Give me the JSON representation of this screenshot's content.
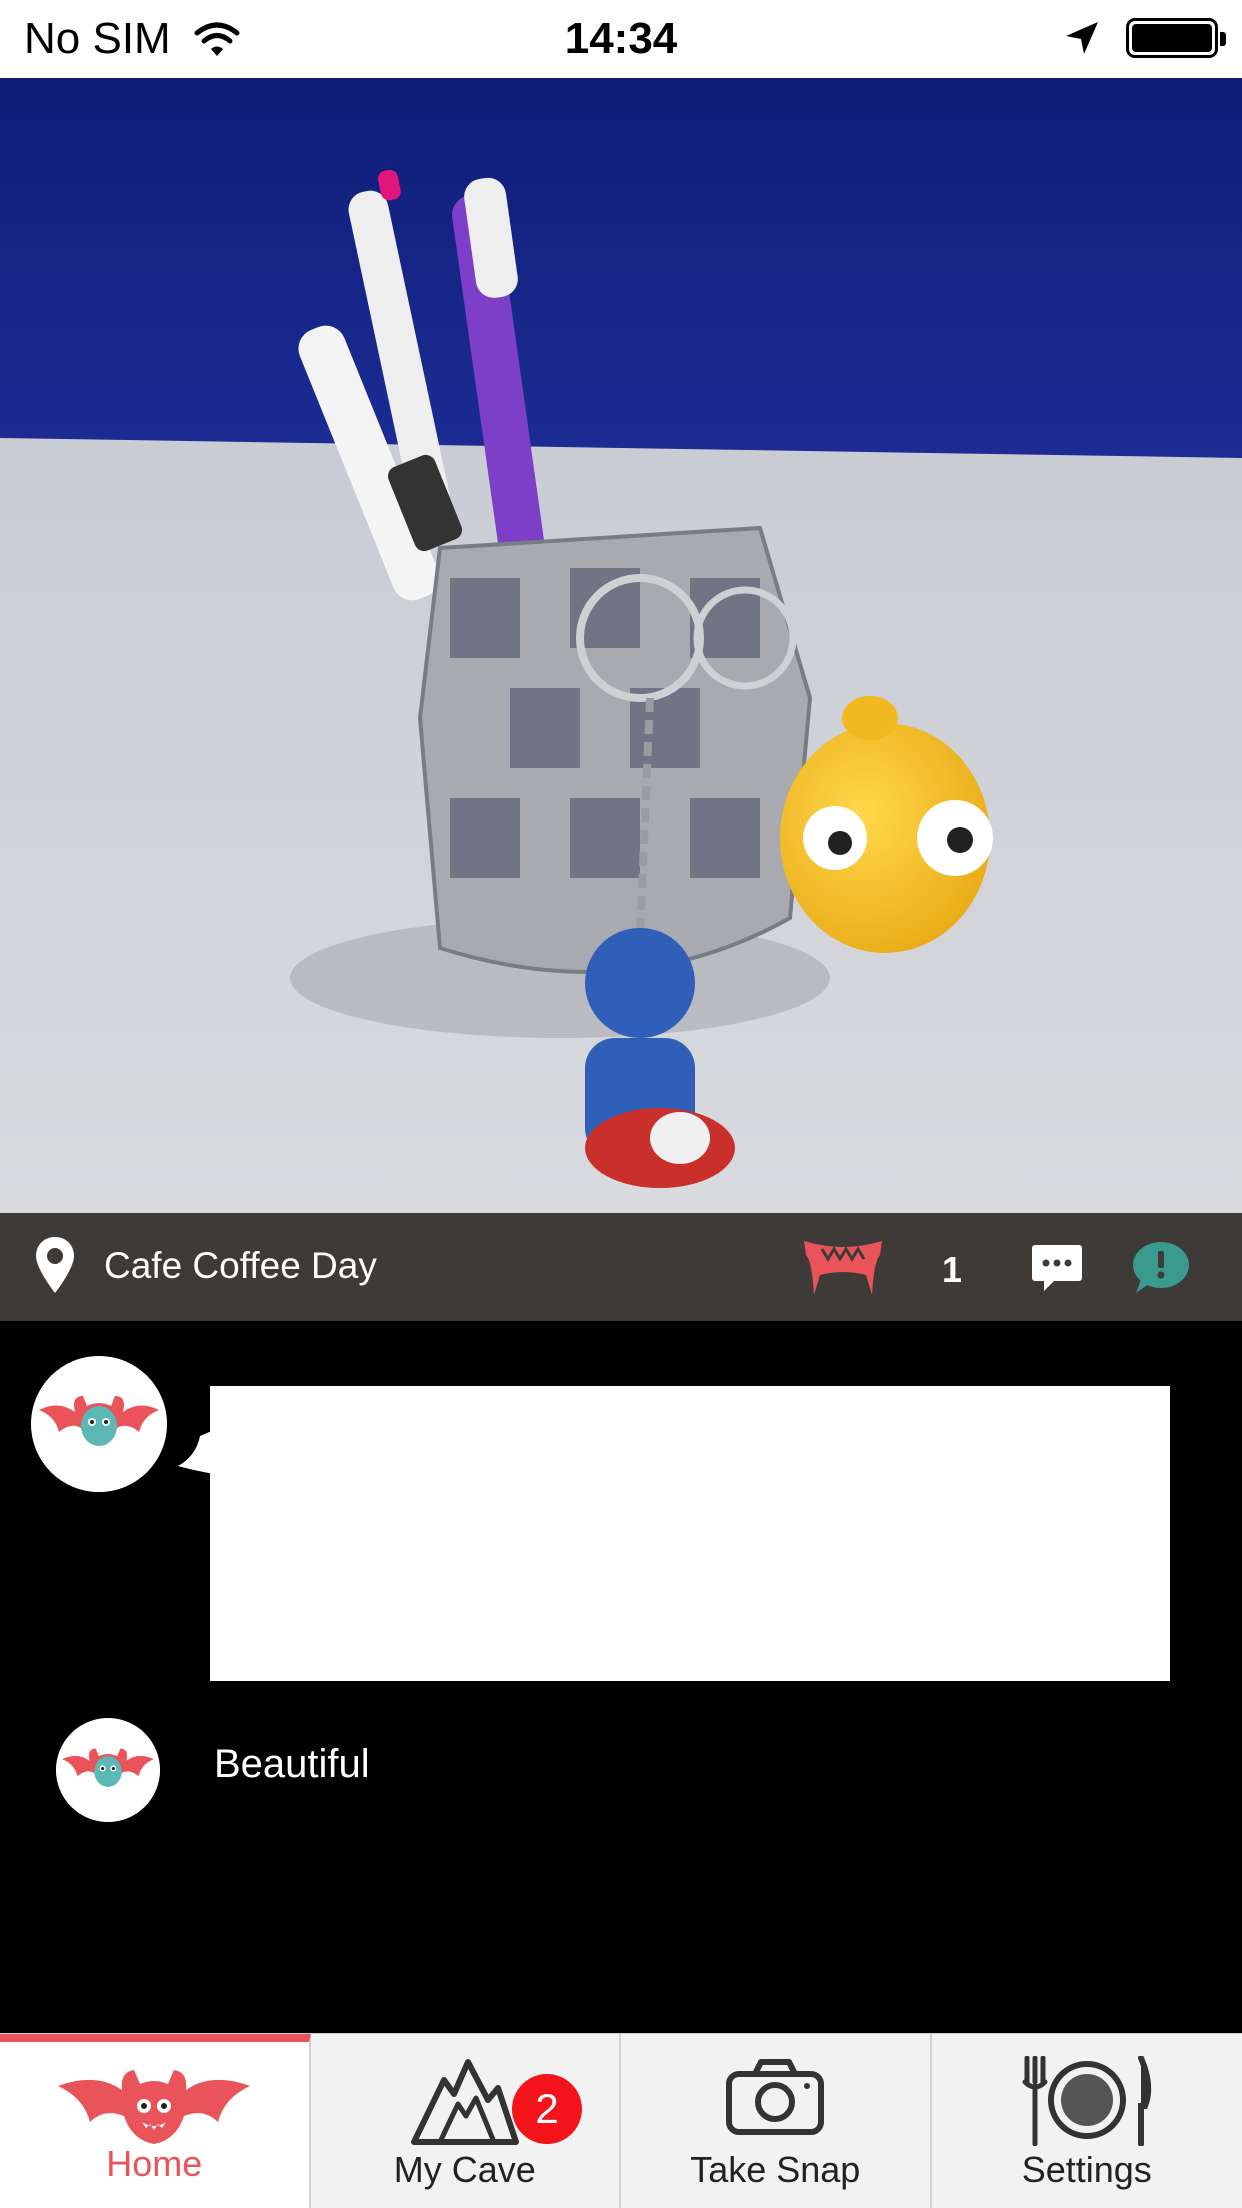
{
  "status_bar": {
    "carrier": "No SIM",
    "time": "14:34"
  },
  "post": {
    "location": "Cafe Coffee Day",
    "bite_count": "1"
  },
  "comments": [
    {
      "text": "Beautiful"
    }
  ],
  "comment_input": {
    "value": ""
  },
  "tabs": [
    {
      "label": "Home",
      "active": true
    },
    {
      "label": "My Cave",
      "badge": "2"
    },
    {
      "label": "Take Snap"
    },
    {
      "label": "Settings"
    }
  ],
  "colors": {
    "accent": "#e8545a",
    "info_bar": "#3d3a38",
    "report_icon": "#3a9a8e",
    "badge": "#f4141c"
  },
  "icons": [
    "location-pin-icon",
    "fangs-icon",
    "comment-icon",
    "report-icon",
    "bat-logo-icon",
    "mountain-icon",
    "camera-icon",
    "plate-cutlery-icon",
    "wifi-icon",
    "location-arrow-icon",
    "battery-icon"
  ]
}
